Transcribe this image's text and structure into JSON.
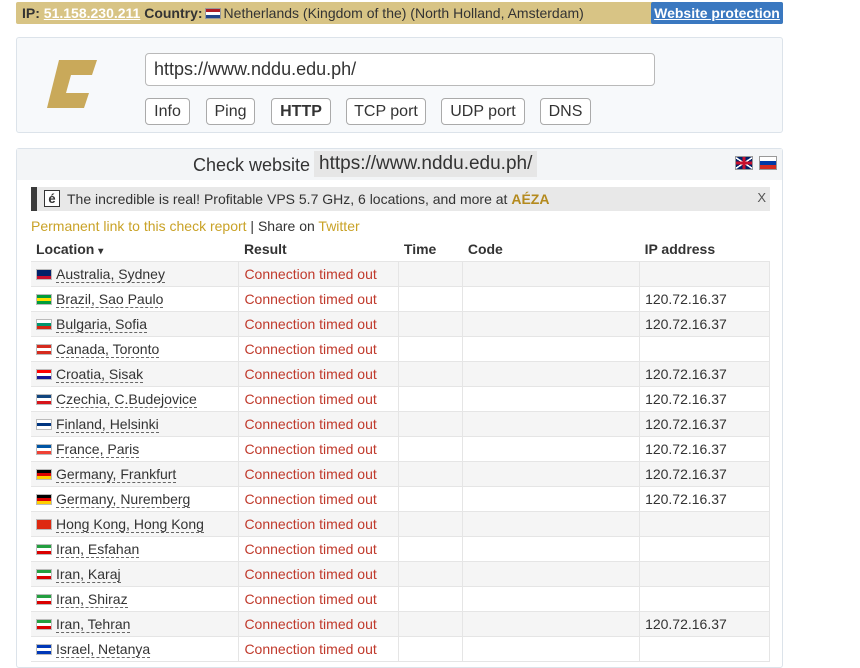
{
  "topbar": {
    "ip_label": "IP:",
    "ip": "51.158.230.211",
    "country_label": "Country:",
    "country": "Netherlands (Kingdom of the) (North Holland, Amsterdam)",
    "protect_label": "Website protection"
  },
  "search": {
    "value": "https://www.nddu.edu.ph/"
  },
  "tabs": [
    {
      "label": "Info"
    },
    {
      "label": "Ping"
    },
    {
      "label": "HTTP"
    },
    {
      "label": "TCP port"
    },
    {
      "label": "UDP port"
    },
    {
      "label": "DNS"
    }
  ],
  "check": {
    "label": "Check website",
    "url": "https://www.nddu.edu.ph/"
  },
  "promo": {
    "icon_letter": "é",
    "text": "The incredible is real! Profitable VPS 5.7 GHz, 6 locations, and more at",
    "brand": "AÉZA",
    "close": "X"
  },
  "links": {
    "permalink": "Permanent link to this check report",
    "separator": " | Share on ",
    "twitter": "Twitter"
  },
  "table": {
    "headers": {
      "location": "Location",
      "sort_arrow": "▾",
      "result": "Result",
      "time": "Time",
      "code": "Code",
      "ip": "IP address"
    },
    "rows": [
      {
        "flag": [
          "#012169",
          "#012169",
          "#c8102e"
        ],
        "location": "Australia, Sydney",
        "result": "Connection timed out",
        "time": "",
        "code": "",
        "ip": ""
      },
      {
        "flag": [
          "#009c3b",
          "#ffdf00",
          "#009c3b"
        ],
        "location": "Brazil, Sao Paulo",
        "result": "Connection timed out",
        "time": "",
        "code": "",
        "ip": "120.72.16.37"
      },
      {
        "flag": [
          "#ffffff",
          "#00966e",
          "#d62612"
        ],
        "location": "Bulgaria, Sofia",
        "result": "Connection timed out",
        "time": "",
        "code": "",
        "ip": "120.72.16.37"
      },
      {
        "flag": [
          "#d52b1e",
          "#ffffff",
          "#d52b1e"
        ],
        "location": "Canada, Toronto",
        "result": "Connection timed out",
        "time": "",
        "code": "",
        "ip": ""
      },
      {
        "flag": [
          "#ff0000",
          "#ffffff",
          "#171796"
        ],
        "location": "Croatia, Sisak",
        "result": "Connection timed out",
        "time": "",
        "code": "",
        "ip": "120.72.16.37"
      },
      {
        "flag": [
          "#11457e",
          "#ffffff",
          "#d7141a"
        ],
        "location": "Czechia, C.Budejovice",
        "result": "Connection timed out",
        "time": "",
        "code": "",
        "ip": "120.72.16.37"
      },
      {
        "flag": [
          "#ffffff",
          "#003580",
          "#ffffff"
        ],
        "location": "Finland, Helsinki",
        "result": "Connection timed out",
        "time": "",
        "code": "",
        "ip": "120.72.16.37"
      },
      {
        "flag": [
          "#0055a4",
          "#ffffff",
          "#ef4135"
        ],
        "location": "France, Paris",
        "result": "Connection timed out",
        "time": "",
        "code": "",
        "ip": "120.72.16.37"
      },
      {
        "flag": [
          "#000000",
          "#dd0000",
          "#ffce00"
        ],
        "location": "Germany, Frankfurt",
        "result": "Connection timed out",
        "time": "",
        "code": "",
        "ip": "120.72.16.37"
      },
      {
        "flag": [
          "#000000",
          "#dd0000",
          "#ffce00"
        ],
        "location": "Germany, Nuremberg",
        "result": "Connection timed out",
        "time": "",
        "code": "",
        "ip": "120.72.16.37"
      },
      {
        "flag": [
          "#de2910",
          "#de2910",
          "#de2910"
        ],
        "location": "Hong Kong, Hong Kong",
        "result": "Connection timed out",
        "time": "",
        "code": "",
        "ip": ""
      },
      {
        "flag": [
          "#239f40",
          "#ffffff",
          "#da0000"
        ],
        "location": "Iran, Esfahan",
        "result": "Connection timed out",
        "time": "",
        "code": "",
        "ip": ""
      },
      {
        "flag": [
          "#239f40",
          "#ffffff",
          "#da0000"
        ],
        "location": "Iran, Karaj",
        "result": "Connection timed out",
        "time": "",
        "code": "",
        "ip": ""
      },
      {
        "flag": [
          "#239f40",
          "#ffffff",
          "#da0000"
        ],
        "location": "Iran, Shiraz",
        "result": "Connection timed out",
        "time": "",
        "code": "",
        "ip": ""
      },
      {
        "flag": [
          "#239f40",
          "#ffffff",
          "#da0000"
        ],
        "location": "Iran, Tehran",
        "result": "Connection timed out",
        "time": "",
        "code": "",
        "ip": "120.72.16.37"
      },
      {
        "flag": [
          "#0038b8",
          "#ffffff",
          "#0038b8"
        ],
        "location": "Israel, Netanya",
        "result": "Connection timed out",
        "time": "",
        "code": "",
        "ip": ""
      }
    ]
  }
}
